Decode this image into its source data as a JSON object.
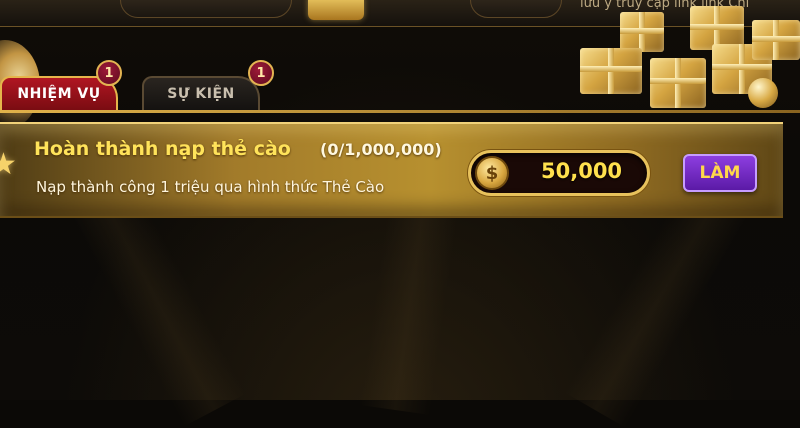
{
  "header": {
    "marquee_text": "lưu ý truy cập link link Chi"
  },
  "tabs": [
    {
      "label": "NHIỆM VỤ",
      "badge": "1",
      "active": true
    },
    {
      "label": "SỰ KIỆN",
      "badge": "1",
      "active": false
    }
  ],
  "task": {
    "title": "Hoàn thành nạp thẻ cào",
    "progress": "(0/1,000,000)",
    "description": "Nạp thành công 1 triệu qua hình thức Thẻ Cào",
    "reward": "50,000",
    "action_label": "LÀM"
  },
  "icons": {
    "coin": "dollar-coin-icon",
    "star": "star-icon"
  },
  "colors": {
    "active_tab": "#b01622",
    "gold": "#e5b54b",
    "title_text": "#ffe35a",
    "action_button": "#7a2dd0"
  }
}
